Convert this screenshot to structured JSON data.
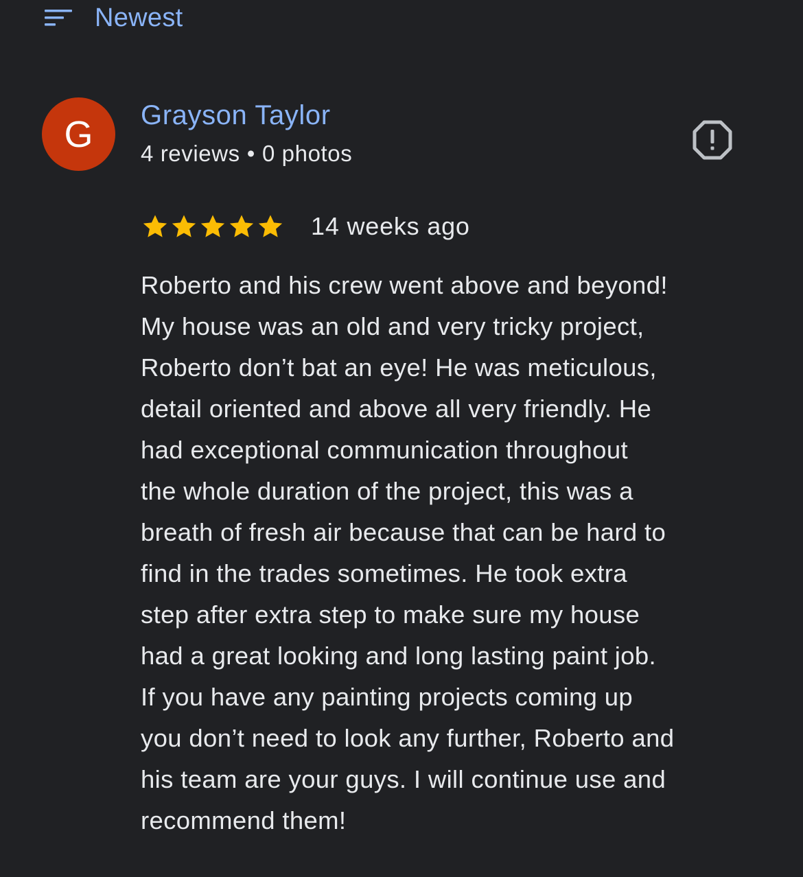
{
  "sort": {
    "icon": "sort-icon",
    "label": "Newest"
  },
  "review": {
    "author": {
      "initial": "G",
      "avatar_color": "#c5360c",
      "name": "Grayson Taylor",
      "reviews_count": "4 reviews",
      "separator": "•",
      "photos_count": "0 photos"
    },
    "report_icon": "report-icon",
    "rating": 5,
    "rating_max": 5,
    "star_color": "#fbbc04",
    "date": "14 weeks ago",
    "text_lines": [
      "Roberto and his crew went above and beyond!",
      "My house was an old and very tricky project,",
      "Roberto don’t bat an eye! He was meticulous,",
      "detail oriented and above all very friendly. He",
      "had exceptional communication throughout",
      "the whole duration of the project, this was a",
      "breath of fresh air because that can be hard to",
      "find in the trades sometimes. He took extra",
      "step after extra step to make sure my house",
      "had a great looking and long lasting paint job.",
      "If you have any painting projects coming up",
      "you don’t need to look any further, Roberto and",
      "his team are your guys. I will continue use and",
      "recommend them!"
    ]
  },
  "colors": {
    "background": "#202124",
    "accent": "#8ab4f8",
    "text": "#e8eaed",
    "icon_gray": "#bdc1c6"
  }
}
